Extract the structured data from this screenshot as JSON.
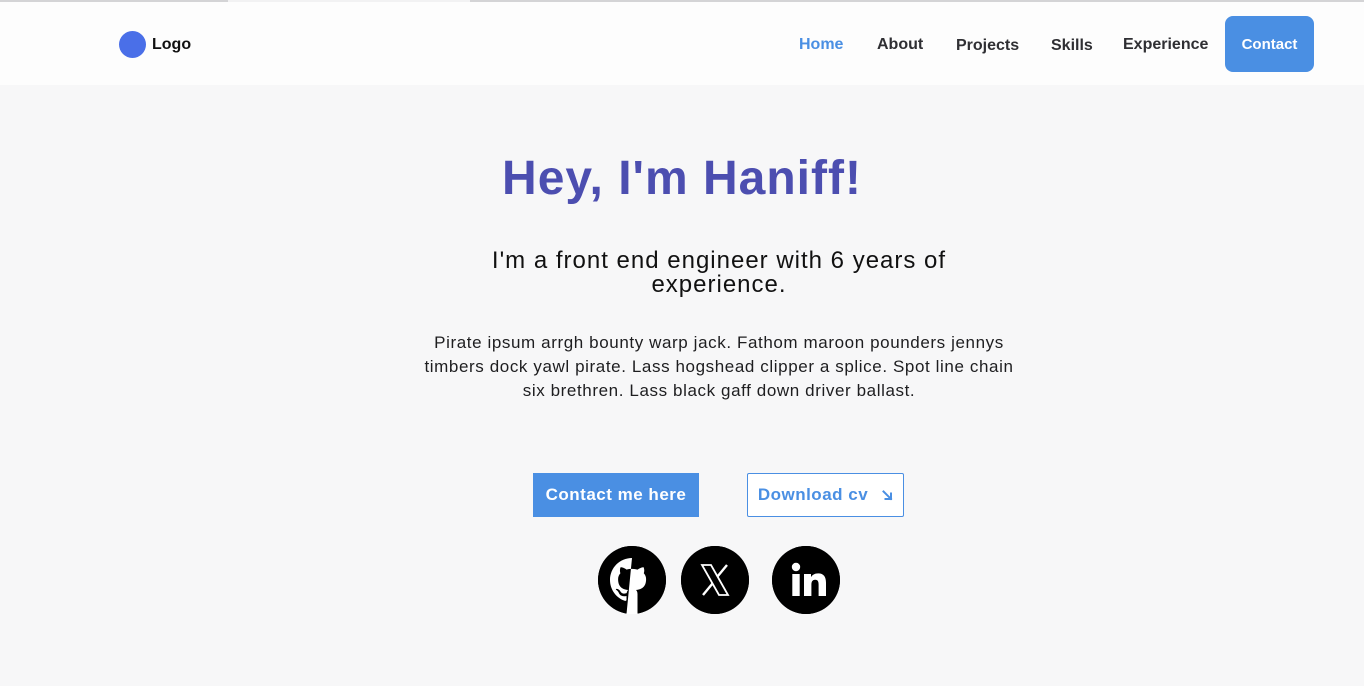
{
  "header": {
    "logo_text": "Logo",
    "nav": [
      {
        "label": "Home"
      },
      {
        "label": "About"
      },
      {
        "label": "Projects"
      },
      {
        "label": "Skills"
      },
      {
        "label": "Experience"
      },
      {
        "label": "Contact"
      }
    ]
  },
  "hero": {
    "title": "Hey, I'm Haniff!",
    "subtitle": "I'm a front end engineer with 6 years of experience.",
    "body": "Pirate ipsum arrgh bounty warp jack. Fathom maroon pounders jennys timbers dock yawl pirate. Lass hogshead clipper a splice. Spot line chain six brethren. Lass black gaff down driver ballast.",
    "primary_button": "Contact me here",
    "secondary_button": "Download cv"
  },
  "social": [
    {
      "icon": "github-icon"
    },
    {
      "icon": "x-icon"
    },
    {
      "icon": "linkedin-icon"
    }
  ],
  "colors": {
    "accent": "#4a8fe3",
    "title": "#4c4eb0",
    "logo_dot": "#4a6fe8",
    "background": "#f7f7f8"
  }
}
